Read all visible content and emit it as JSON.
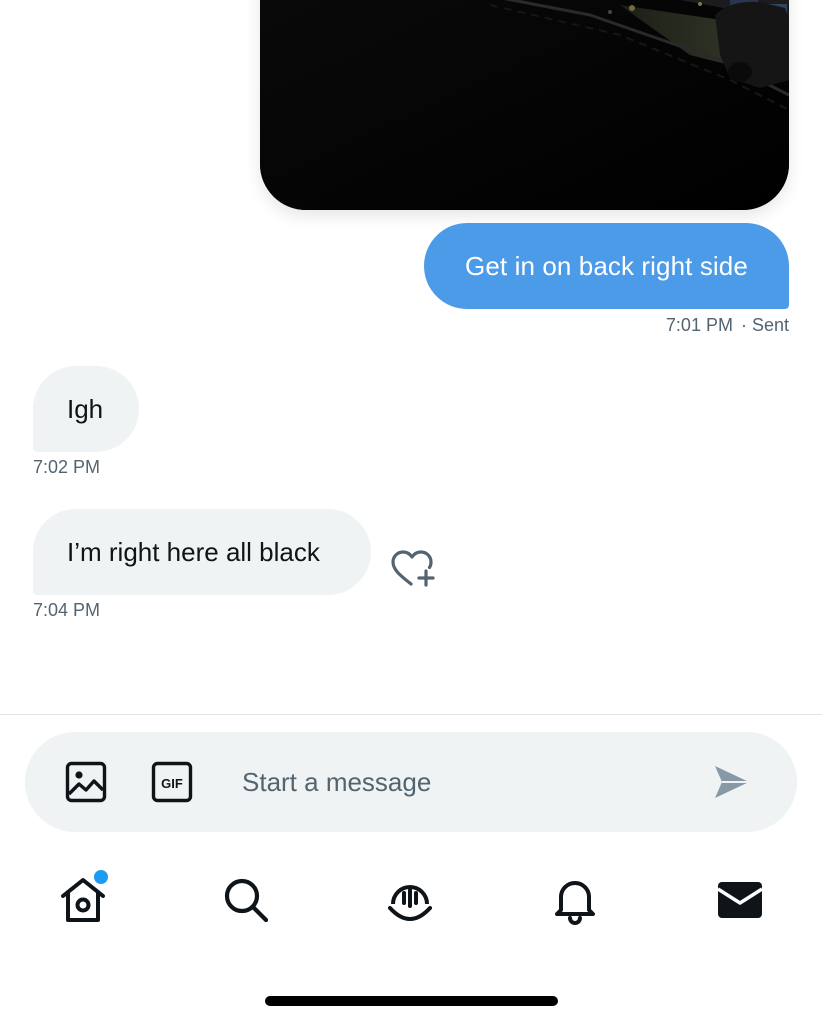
{
  "conversation": {
    "messages": [
      {
        "direction": "outgoing",
        "type": "image",
        "image_description": "dark night-time street photo with parked car"
      },
      {
        "direction": "outgoing",
        "type": "text",
        "text": "Get in on back right side",
        "time": "7:01 PM",
        "status": "· Sent"
      },
      {
        "direction": "incoming",
        "type": "text",
        "text": "Igh",
        "time": "7:02 PM"
      },
      {
        "direction": "incoming",
        "type": "text",
        "text": "I’m right here all black",
        "time": "7:04 PM"
      }
    ],
    "reaction_icon": "heart-plus-icon"
  },
  "composer": {
    "placeholder": "Start a message",
    "value": "",
    "media_icon": "image-icon",
    "gif_label": "GIF",
    "send_icon": "send-icon"
  },
  "tabbar": {
    "tabs": [
      {
        "name": "home",
        "icon": "home-icon",
        "has_notification_dot": true
      },
      {
        "name": "search",
        "icon": "search-icon"
      },
      {
        "name": "spaces",
        "icon": "spaces-icon"
      },
      {
        "name": "notifications",
        "icon": "bell-icon"
      },
      {
        "name": "messages",
        "icon": "mail-icon",
        "active": true
      }
    ]
  },
  "colors": {
    "accent": "#1d9bf0",
    "sent_bubble": "#4c9be8",
    "received_bubble": "#eff3f4",
    "secondary_text": "#536471"
  }
}
